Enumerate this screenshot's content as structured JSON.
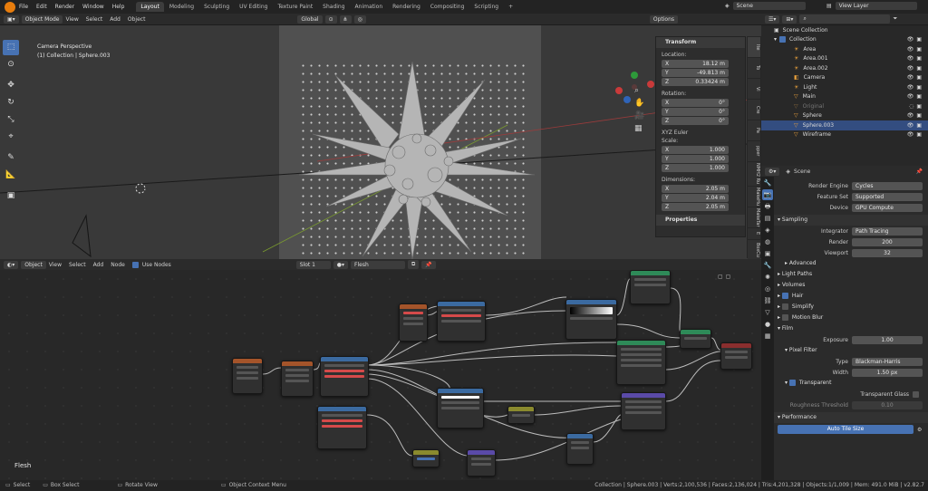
{
  "menubar": {
    "items": [
      "File",
      "Edit",
      "Render",
      "Window",
      "Help"
    ],
    "workspaces": [
      "Layout",
      "Modeling",
      "Sculpting",
      "UV Editing",
      "Texture Paint",
      "Shading",
      "Animation",
      "Rendering",
      "Compositing",
      "Scripting"
    ],
    "active_workspace": "Layout",
    "scene_label": "Scene",
    "view_layer_label": "View Layer"
  },
  "viewport_header": {
    "mode": "Object Mode",
    "menus": [
      "View",
      "Select",
      "Add",
      "Object"
    ],
    "transform_orientation": "Global",
    "options_label": "Options"
  },
  "viewport": {
    "camera_label": "Camera Perspective",
    "collection_label": "(1) Collection | Sphere.003"
  },
  "npanel": {
    "transform_title": "Transform",
    "location_label": "Location:",
    "location": [
      {
        "axis": "X",
        "value": "18.12 m"
      },
      {
        "axis": "Y",
        "value": "-49.813 m"
      },
      {
        "axis": "Z",
        "value": "0.33424 m"
      }
    ],
    "rotation_label": "Rotation:",
    "rotation": [
      {
        "axis": "X",
        "value": "0°"
      },
      {
        "axis": "Y",
        "value": "0°"
      },
      {
        "axis": "Z",
        "value": "0°"
      }
    ],
    "rotation_mode": "XYZ Euler",
    "scale_label": "Scale:",
    "scale": [
      {
        "axis": "X",
        "value": "1.000"
      },
      {
        "axis": "Y",
        "value": "1.000"
      },
      {
        "axis": "Z",
        "value": "1.000"
      }
    ],
    "dimensions_label": "Dimensions:",
    "dimensions": [
      {
        "axis": "X",
        "value": "2.05 m"
      },
      {
        "axis": "Y",
        "value": "2.04 m"
      },
      {
        "axis": "Z",
        "value": "2.05 m"
      }
    ],
    "properties_title": "Properties",
    "tabs": [
      "Ite",
      "To",
      "Vi",
      "Cre",
      "Pa",
      "pper",
      "NMH2 Ru",
      "MakeHu",
      "MakeTar",
      "E",
      "BoxCu"
    ]
  },
  "node_editor_header": {
    "type": "Object",
    "menus": [
      "View",
      "Select",
      "Add",
      "Node"
    ],
    "use_nodes_label": "Use Nodes",
    "slot": "Slot 1",
    "material": "Flesh"
  },
  "node_editor": {
    "material_name": "Flesh"
  },
  "outliner": {
    "root": "Scene Collection",
    "collection": "Collection",
    "items": [
      {
        "name": "Area",
        "selected": false
      },
      {
        "name": "Area.001",
        "selected": false
      },
      {
        "name": "Area.002",
        "selected": false
      },
      {
        "name": "Camera",
        "selected": false
      },
      {
        "name": "Light",
        "selected": false
      },
      {
        "name": "Main",
        "selected": false
      },
      {
        "name": "Original",
        "selected": false
      },
      {
        "name": "Sphere",
        "selected": false
      },
      {
        "name": "Sphere.003",
        "selected": true
      },
      {
        "name": "Wireframe",
        "selected": false
      }
    ]
  },
  "properties": {
    "scene_label": "Scene",
    "render_engine_label": "Render Engine",
    "render_engine": "Cycles",
    "feature_set_label": "Feature Set",
    "feature_set": "Supported",
    "device_label": "Device",
    "device": "GPU Compute",
    "sampling_title": "Sampling",
    "integrator_label": "Integrator",
    "integrator": "Path Tracing",
    "render_samples_label": "Render",
    "render_samples": "200",
    "viewport_samples_label": "Viewport",
    "viewport_samples": "32",
    "advanced_label": "Advanced",
    "light_paths_label": "Light Paths",
    "volumes_label": "Volumes",
    "hair_label": "Hair",
    "simplify_label": "Simplify",
    "motion_blur_label": "Motion Blur",
    "film_label": "Film",
    "exposure_label": "Exposure",
    "exposure": "1.00",
    "pixel_filter_label": "Pixel Filter",
    "filter_type_label": "Type",
    "filter_type": "Blackman-Harris",
    "width_label": "Width",
    "width": "1.50 px",
    "transparent_label": "Transparent",
    "transparent_glass_label": "Transparent Glass",
    "roughness_threshold_label": "Roughness Threshold",
    "roughness_threshold": "0.10",
    "performance_label": "Performance",
    "auto_tile_label": "Auto Tile Size"
  },
  "statusbar": {
    "select": "Select",
    "box_select": "Box Select",
    "rotate_view": "Rotate View",
    "context_menu": "Object Context Menu",
    "stats": "Collection | Sphere.003 | Verts:2,100,536 | Faces:2,136,024 | Tris:4,201,328 | Objects:1/1,009 | Mem: 491.0 MiB | v2.82.7"
  }
}
